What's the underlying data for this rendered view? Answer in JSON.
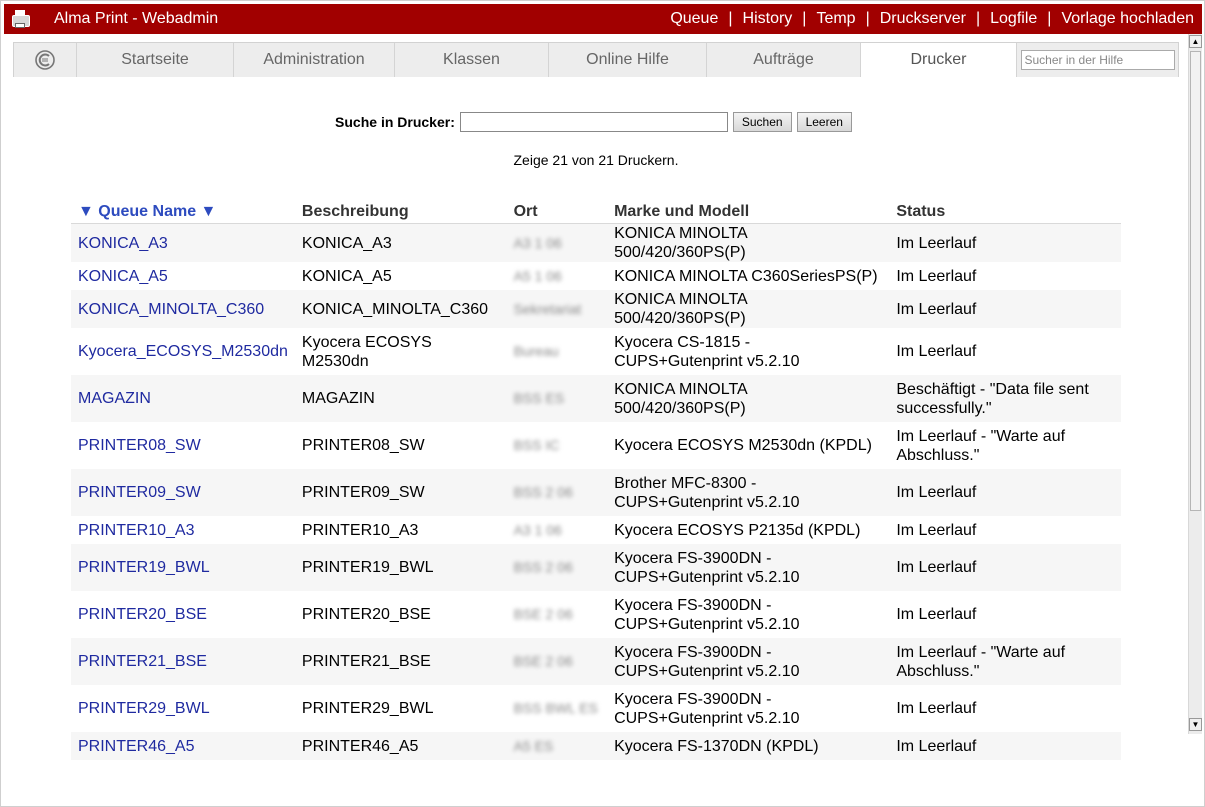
{
  "titlebar": {
    "title": "Alma Print - Webadmin",
    "nav": [
      "Queue",
      "History",
      "Temp",
      "Druckserver",
      "Logfile",
      "Vorlage hochladen"
    ],
    "separator": "|"
  },
  "tabs": {
    "items": [
      "Startseite",
      "Administration",
      "Klassen",
      "Online Hilfe",
      "Aufträge",
      "Drucker"
    ],
    "active": "Drucker",
    "search_placeholder": "Sucher in der Hilfe"
  },
  "search": {
    "label": "Suche in Drucker:",
    "value": "",
    "search_button": "Suchen",
    "clear_button": "Leeren"
  },
  "count_text": "Zeige 21 von 21 Druckern.",
  "table": {
    "headers": [
      "▼ Queue Name ▼",
      "Beschreibung",
      "Ort",
      "Marke und Modell",
      "Status"
    ],
    "rows": [
      {
        "queue": "KONICA_A3",
        "desc": "KONICA_A3",
        "loc": "A3 1 06",
        "model": "KONICA MINOLTA 500/420/360PS(P)",
        "status": "Im Leerlauf"
      },
      {
        "queue": "KONICA_A5",
        "desc": "KONICA_A5",
        "loc": "A5 1 06",
        "model": "KONICA MINOLTA C360SeriesPS(P)",
        "status": "Im Leerlauf"
      },
      {
        "queue": "KONICA_MINOLTA_C360",
        "desc": "KONICA_MINOLTA_C360",
        "loc": "Sekretariat",
        "model": "KONICA MINOLTA 500/420/360PS(P)",
        "status": "Im Leerlauf"
      },
      {
        "queue": "Kyocera_ECOSYS_M2530dn",
        "desc": "Kyocera ECOSYS M2530dn",
        "loc": "Bureau",
        "model": "Kyocera CS-1815 - CUPS+Gutenprint v5.2.10",
        "status": "Im Leerlauf"
      },
      {
        "queue": "MAGAZIN",
        "desc": "MAGAZIN",
        "loc": "BSS ES",
        "model": "KONICA MINOLTA 500/420/360PS(P)",
        "status": "Beschäftigt - \"Data file sent successfully.\""
      },
      {
        "queue": "PRINTER08_SW",
        "desc": "PRINTER08_SW",
        "loc": "BSS IC",
        "model": "Kyocera ECOSYS M2530dn (KPDL)",
        "status": "Im Leerlauf - \"Warte auf Abschluss.\""
      },
      {
        "queue": "PRINTER09_SW",
        "desc": "PRINTER09_SW",
        "loc": "BSS 2 06",
        "model": "Brother MFC-8300 - CUPS+Gutenprint v5.2.10",
        "status": "Im Leerlauf"
      },
      {
        "queue": "PRINTER10_A3",
        "desc": "PRINTER10_A3",
        "loc": "A3 1 06",
        "model": "Kyocera ECOSYS P2135d (KPDL)",
        "status": "Im Leerlauf"
      },
      {
        "queue": "PRINTER19_BWL",
        "desc": "PRINTER19_BWL",
        "loc": "BSS 2 06",
        "model": "Kyocera FS-3900DN - CUPS+Gutenprint v5.2.10",
        "status": "Im Leerlauf"
      },
      {
        "queue": "PRINTER20_BSE",
        "desc": "PRINTER20_BSE",
        "loc": "BSE 2 06",
        "model": "Kyocera FS-3900DN - CUPS+Gutenprint v5.2.10",
        "status": "Im Leerlauf"
      },
      {
        "queue": "PRINTER21_BSE",
        "desc": "PRINTER21_BSE",
        "loc": "BSE 2 06",
        "model": "Kyocera FS-3900DN - CUPS+Gutenprint v5.2.10",
        "status": "Im Leerlauf - \"Warte auf Abschluss.\""
      },
      {
        "queue": "PRINTER29_BWL",
        "desc": "PRINTER29_BWL",
        "loc": "BSS BWL ES",
        "model": "Kyocera FS-3900DN - CUPS+Gutenprint v5.2.10",
        "status": "Im Leerlauf"
      },
      {
        "queue": "PRINTER46_A5",
        "desc": "PRINTER46_A5",
        "loc": "A5 ES",
        "model": "Kyocera FS-1370DN (KPDL)",
        "status": "Im Leerlauf"
      }
    ]
  }
}
